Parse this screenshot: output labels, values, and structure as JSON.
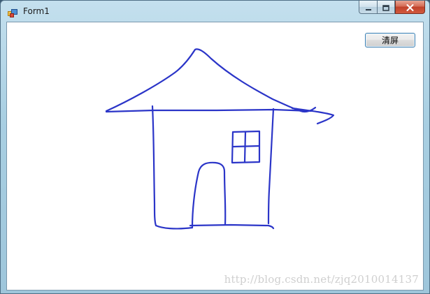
{
  "window": {
    "title": "Form1",
    "icons": {
      "app": "app-form-icon",
      "minimize": "minimize-icon",
      "maximize": "maximize-icon",
      "close": "close-icon"
    }
  },
  "toolbar": {
    "clear_label": "清屏"
  },
  "drawing": {
    "pen_color": "#2b35c8",
    "background": "#ffffff"
  },
  "watermark": "http://blog.csdn.net/zjq2010014137"
}
